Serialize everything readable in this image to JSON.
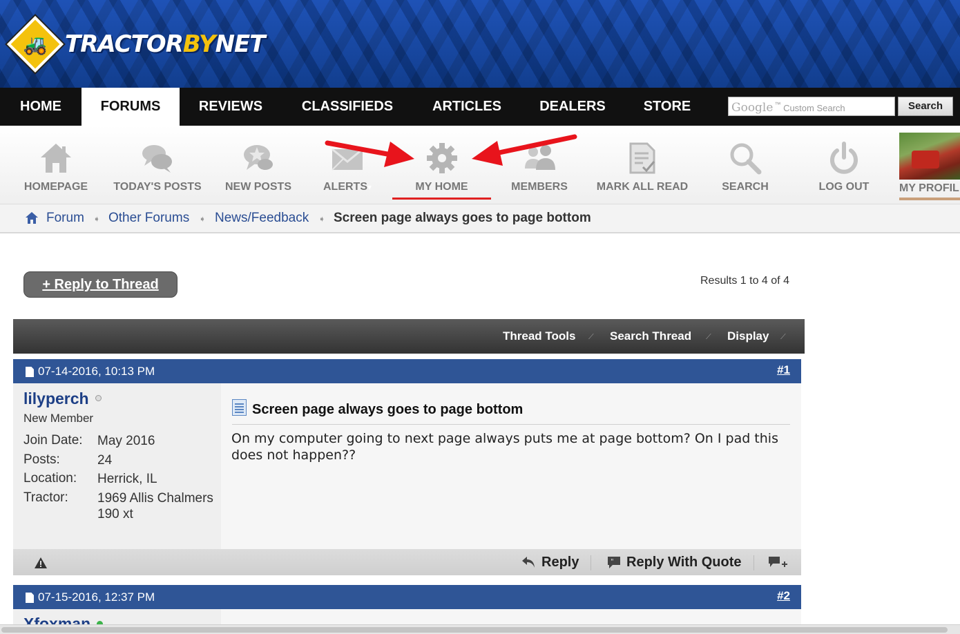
{
  "header": {
    "logo": {
      "part1": "TRACTOR",
      "part2": "BY",
      "part3": "NET"
    }
  },
  "topnav": {
    "items": [
      {
        "label": "HOME",
        "active": false
      },
      {
        "label": "FORUMS",
        "active": true
      },
      {
        "label": "REVIEWS",
        "active": false
      },
      {
        "label": "CLASSIFIEDS",
        "active": false
      },
      {
        "label": "ARTICLES",
        "active": false
      },
      {
        "label": "DEALERS",
        "active": false
      },
      {
        "label": "STORE",
        "active": false
      }
    ],
    "search": {
      "brand": "Google",
      "tm": "™",
      "placeholder": "Custom Search",
      "button": "Search"
    }
  },
  "iconnav": {
    "items": [
      {
        "label": "HOMEPAGE",
        "icon": "house-icon"
      },
      {
        "label": "TODAY'S POSTS",
        "icon": "speech-bubbles-icon"
      },
      {
        "label": "NEW POSTS",
        "icon": "star-bubble-icon"
      },
      {
        "label": "ALERTS",
        "icon": "envelope-icon",
        "dropdown": "▾"
      },
      {
        "label": "MY HOME",
        "icon": "gear-icon",
        "highlighted": true
      },
      {
        "label": "MEMBERS",
        "icon": "people-icon"
      },
      {
        "label": "MARK ALL READ",
        "icon": "document-check-icon"
      },
      {
        "label": "SEARCH",
        "icon": "magnifier-icon"
      },
      {
        "label": "LOG OUT",
        "icon": "power-icon"
      },
      {
        "label": "MY PROFIL",
        "icon": "profile-photo"
      }
    ],
    "accent": "#e02020"
  },
  "breadcrumb": {
    "items": [
      "Forum",
      "Other Forums",
      "News/Feedback"
    ],
    "current": "Screen page always goes to page bottom"
  },
  "thread": {
    "reply_button": "+ Reply to Thread",
    "results": "Results 1 to 4 of 4",
    "tools": [
      "Thread Tools",
      "Search Thread",
      "Display"
    ]
  },
  "posts": [
    {
      "date": "07-14-2016, 10:13 PM",
      "number": "#1",
      "username": "lilyperch",
      "user_title": "New Member",
      "info": [
        {
          "label": "Join Date:",
          "value": "May 2016"
        },
        {
          "label": "Posts:",
          "value": "24"
        },
        {
          "label": "Location:",
          "value": "Herrick, IL"
        },
        {
          "label": "Tractor:",
          "value": "1969 Allis Chalmers 190 xt"
        }
      ],
      "title": "Screen page always goes to page bottom",
      "body": "On my computer going to next page always puts me at page bottom? On I pad this does not happen??",
      "actions": {
        "reply": "Reply",
        "reply_quote": "Reply With Quote"
      }
    },
    {
      "date": "07-15-2016, 12:37 PM",
      "number": "#2",
      "username": "Xfoxman"
    }
  ],
  "colors": {
    "header_blue": "#1a4fb5",
    "post_header": "#2f5596",
    "link": "#2a4d93",
    "username": "#1d3f86",
    "arrow": "#e8141c"
  }
}
